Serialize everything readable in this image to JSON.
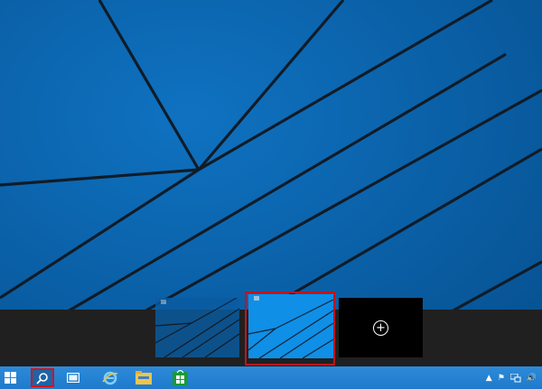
{
  "screen": {
    "desktop_color": "#0b66b4",
    "line_color": "#0e1a24"
  },
  "virtual_desktops": {
    "items": [
      {
        "name": "desktop-1",
        "selected": false
      },
      {
        "name": "desktop-2",
        "selected": true
      }
    ],
    "new_desktop_symbol": "+"
  },
  "taskbar": {
    "accent": "#2384d4",
    "highlight_color": "#d0151e",
    "icons": [
      "windows-start-icon",
      "search-icon",
      "task-view-icon",
      "internet-explorer-icon",
      "file-explorer-icon",
      "store-icon"
    ],
    "tray": {
      "chevron": "▲",
      "flag": "⚑",
      "volume": "🔊"
    }
  }
}
